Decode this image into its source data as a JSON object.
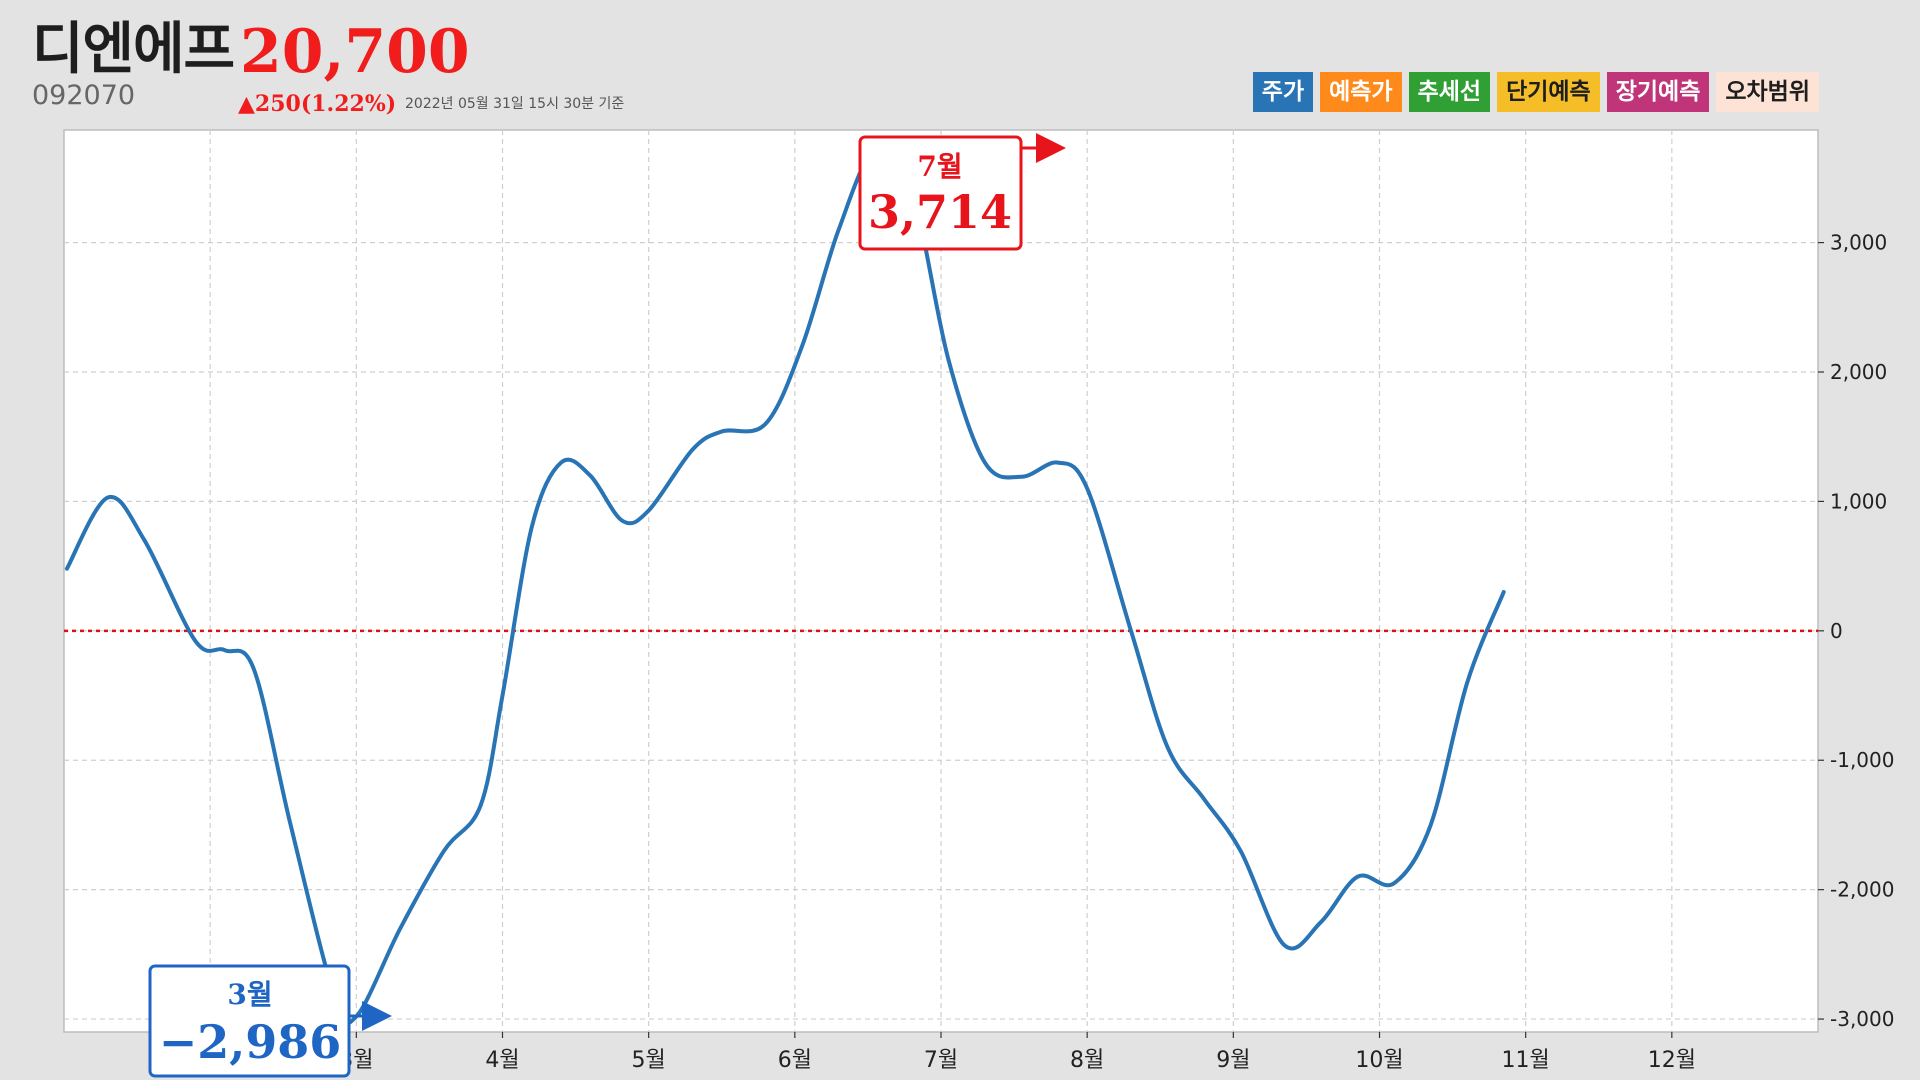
{
  "header": {
    "name": "디엔에프",
    "price": "20,700",
    "ticker": "092070",
    "change": "▲250(1.22%)",
    "as_of": "2022년 05월 31일 15시 30분 기준"
  },
  "legend": [
    {
      "label": "주가",
      "color": "#2874b5",
      "text_color": "#ffffff"
    },
    {
      "label": "예측가",
      "color": "#ff8a1c",
      "text_color": "#ffffff"
    },
    {
      "label": "추세선",
      "color": "#30a035",
      "text_color": "#ffffff"
    },
    {
      "label": "단기예측",
      "color": "#f5be28",
      "text_color": "#1e1e1e"
    },
    {
      "label": "장기예측",
      "color": "#c0357a",
      "text_color": "#ffffff"
    },
    {
      "label": "오차범위",
      "color": "#fce3d6",
      "text_color": "#1e1e1e"
    }
  ],
  "chart_data": {
    "type": "line",
    "ylim": [
      -3100,
      3870
    ],
    "y_ticks": [
      3000,
      2000,
      1000,
      0,
      -1000,
      -2000,
      -3000
    ],
    "y_tick_labels": [
      "3,000",
      "2,000",
      "1,000",
      "0",
      "-1,000",
      "-2,000",
      "-3,000"
    ],
    "x_ticks": [
      2,
      3,
      4,
      5,
      6,
      7,
      8,
      9,
      10,
      11,
      12
    ],
    "x_tick_labels": [
      "",
      "3월",
      "4월",
      "5월",
      "6월",
      "7월",
      "8월",
      "9월",
      "10월",
      "11월",
      "12월"
    ],
    "xlim": [
      1.0,
      13.0
    ],
    "zero_line_color": "#e01010",
    "line_color": "#2874b5",
    "grid": true,
    "series": [
      {
        "points": [
          [
            1.02,
            480
          ],
          [
            1.3,
            1030
          ],
          [
            1.55,
            700
          ],
          [
            1.9,
            -80
          ],
          [
            2.1,
            -150
          ],
          [
            2.3,
            -300
          ],
          [
            2.55,
            -1500
          ],
          [
            2.85,
            -2820
          ],
          [
            3.0,
            -2980
          ],
          [
            3.3,
            -2300
          ],
          [
            3.6,
            -1700
          ],
          [
            3.85,
            -1350
          ],
          [
            4.0,
            -500
          ],
          [
            4.2,
            800
          ],
          [
            4.4,
            1300
          ],
          [
            4.6,
            1200
          ],
          [
            4.82,
            850
          ],
          [
            5.0,
            930
          ],
          [
            5.3,
            1400
          ],
          [
            5.5,
            1540
          ],
          [
            5.8,
            1600
          ],
          [
            6.05,
            2200
          ],
          [
            6.3,
            3100
          ],
          [
            6.55,
            3714
          ],
          [
            6.8,
            3400
          ],
          [
            7.05,
            2100
          ],
          [
            7.3,
            1300
          ],
          [
            7.55,
            1190
          ],
          [
            7.8,
            1300
          ],
          [
            8.0,
            1100
          ],
          [
            8.3,
            0
          ],
          [
            8.55,
            -900
          ],
          [
            8.8,
            -1300
          ],
          [
            9.05,
            -1700
          ],
          [
            9.35,
            -2430
          ],
          [
            9.6,
            -2250
          ],
          [
            9.85,
            -1900
          ],
          [
            10.1,
            -1950
          ],
          [
            10.35,
            -1500
          ],
          [
            10.6,
            -400
          ],
          [
            10.85,
            300
          ]
        ]
      }
    ],
    "annotations": [
      {
        "month": "7월",
        "value": "3,714",
        "color": "#e8141b"
      },
      {
        "month": "3월",
        "value": "−2,986",
        "color": "#1f66c4"
      }
    ]
  }
}
